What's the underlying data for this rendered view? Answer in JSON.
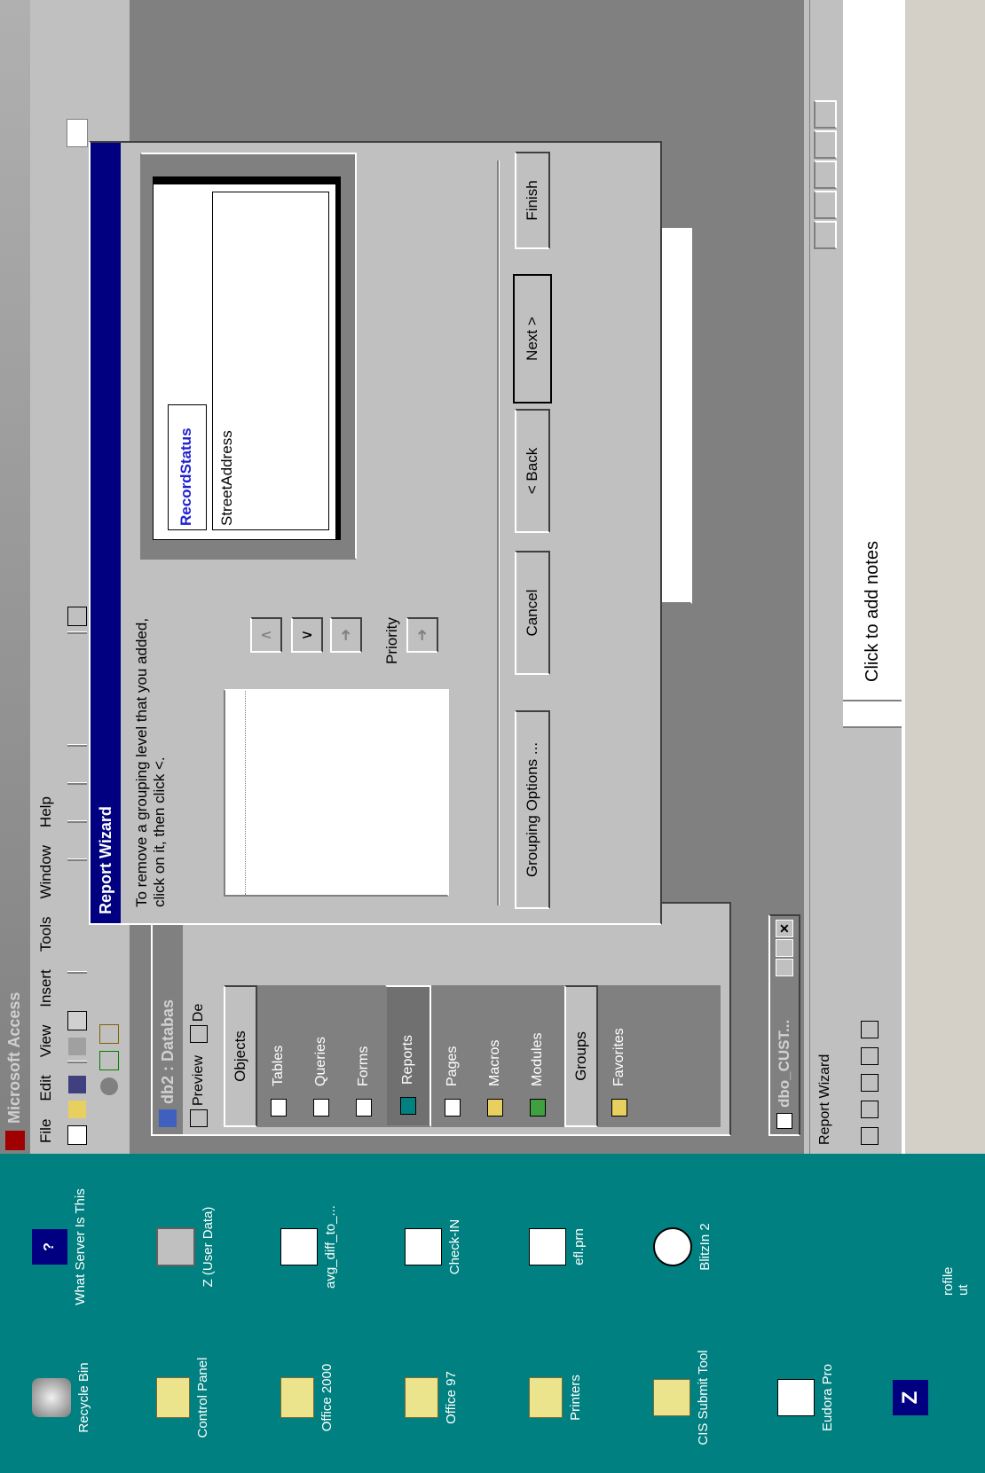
{
  "titlebar": {
    "title": "Microsoft Access"
  },
  "menu": [
    "File",
    "Edit",
    "View",
    "Insert",
    "Tools",
    "Window",
    "Help"
  ],
  "desktop_icons": [
    {
      "label": "Recycle Bin",
      "icon": "recycle-bin-icon"
    },
    {
      "label": "Control Panel",
      "icon": "folder-icon"
    },
    {
      "label": "Office 2000",
      "icon": "folder-icon"
    },
    {
      "label": "Office 97",
      "icon": "folder-icon"
    },
    {
      "label": "Printers",
      "icon": "printers-icon"
    },
    {
      "label": "CIS Submit Tool",
      "icon": "envelope-icon"
    },
    {
      "label": "Eudora Pro",
      "icon": "eudora-icon"
    },
    {
      "label": "",
      "icon": "z-app-icon"
    },
    {
      "label": "What Server Is This",
      "icon": "help-icon"
    },
    {
      "label": "Z (User Data)",
      "icon": "drive-icon"
    },
    {
      "label": "avg_diff_to_...",
      "icon": "chart-icon"
    },
    {
      "label": "Check-IN",
      "icon": "checkin-icon"
    },
    {
      "label": "efl.prn",
      "icon": "chart-icon"
    },
    {
      "label": "BlitzIn 2",
      "icon": "blitz-icon"
    },
    {
      "label": "rofile",
      "icon": ""
    },
    {
      "label": "ut",
      "icon": ""
    }
  ],
  "db_window": {
    "title": "db2 : Databas",
    "preview": "Preview",
    "design": "De",
    "objects_header": "Objects",
    "objects": [
      "Tables",
      "Queries",
      "Forms",
      "Reports",
      "Pages",
      "Macros",
      "Modules"
    ],
    "groups_header": "Groups",
    "favorites": "Favorites"
  },
  "minimized_window": {
    "title": "dbo_CUST..."
  },
  "wizard": {
    "title": "Report Wizard",
    "instruction": "To remove a grouping level that you added, click on it, then click <.",
    "priority_label": "Priority",
    "preview_group_field": "RecordStatus",
    "preview_detail_field": "StreetAddress",
    "buttons": {
      "grouping": "Grouping Options ...",
      "cancel": "Cancel",
      "back": "< Back",
      "next": "Next >",
      "finish": "Finish"
    }
  },
  "statusbar": {
    "text": "Report Wizard"
  },
  "notes": {
    "placeholder": "Click to add notes"
  }
}
